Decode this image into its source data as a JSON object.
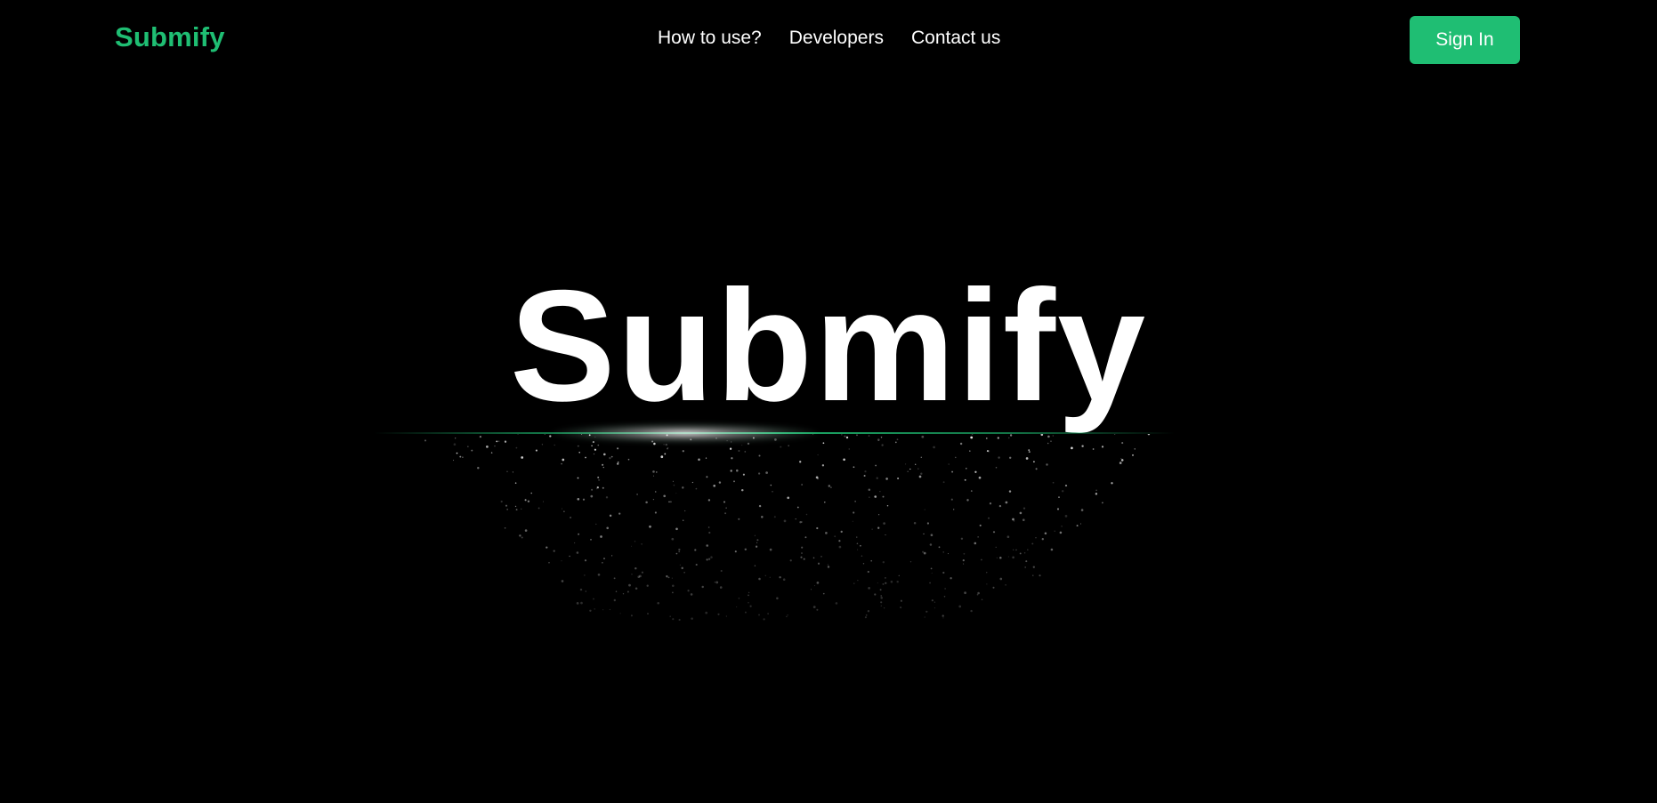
{
  "header": {
    "logo": "Submify",
    "nav": [
      {
        "label": "How to use?"
      },
      {
        "label": "Developers"
      },
      {
        "label": "Contact us"
      }
    ],
    "signin_label": "Sign In"
  },
  "hero": {
    "title": "Submify"
  },
  "colors": {
    "background": "#000000",
    "brand": "#1fbe73",
    "text": "#ffffff"
  }
}
